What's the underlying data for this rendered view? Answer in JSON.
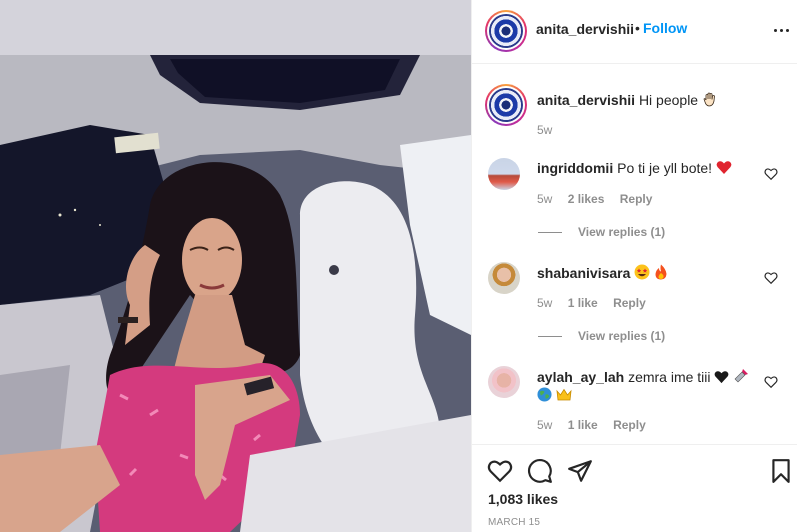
{
  "post": {
    "username": "anita_dervishii",
    "dot": "•",
    "follow_label": "Follow",
    "more_icon": "more-options-icon",
    "likes_count": "1,083 likes",
    "date": "MARCH 15"
  },
  "caption": {
    "username": "anita_dervishii",
    "text": "Hi people",
    "emoji": "waving-hand",
    "time": "5w"
  },
  "comments": [
    {
      "username": "ingriddomii",
      "text": "Po ti je yll bote!",
      "emoji": "red-heart",
      "time": "5w",
      "likes": "2 likes",
      "reply": "Reply",
      "view_replies": "View replies (1)"
    },
    {
      "username": "shabanivisara",
      "text": "",
      "emoji": "star-struck, fire",
      "time": "5w",
      "likes": "1 like",
      "reply": "Reply",
      "view_replies": "View replies (1)"
    },
    {
      "username": "aylah_ay_lah",
      "text": "zemra ime tiii",
      "emoji": "black-heart, lipstick, globe, crown",
      "time": "5w",
      "likes": "1 like",
      "reply": "Reply"
    }
  ],
  "actions": {
    "like_icon": "heart-outline-icon",
    "comment_icon": "comment-icon",
    "share_icon": "paper-plane-icon",
    "save_icon": "bookmark-icon"
  },
  "colors": {
    "follow_blue": "#0095f6",
    "meta_gray": "#8e8e8e",
    "text_dark": "#262626",
    "dress_pink": "#d43a7e"
  }
}
